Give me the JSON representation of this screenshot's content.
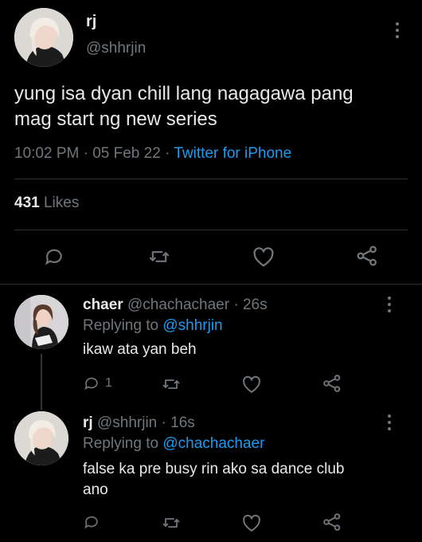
{
  "main_tweet": {
    "display_name": "rj",
    "handle": "@shhrjin",
    "text_line1": "yung isa dyan chill lang nagagawa pang",
    "text_line2": "mag start ng new series",
    "time": "10:02 PM",
    "sep1": "·",
    "date": "05 Feb 22",
    "sep2": "·",
    "source": "Twitter for iPhone",
    "likes_count": "431",
    "likes_label": "Likes"
  },
  "replies": [
    {
      "display_name": "chaer",
      "handle": "@chachachaer",
      "sep": "·",
      "age": "26s",
      "replying_prefix": "Replying to",
      "replying_to": "@shhrjin",
      "text": "ikaw ata yan beh",
      "reply_count": "1"
    },
    {
      "display_name": "rj",
      "handle": "@shhrjin",
      "sep": "·",
      "age": "16s",
      "replying_prefix": "Replying to",
      "replying_to": "@chachachaer",
      "text_line1": "false ka pre busy rin ako sa dance club",
      "text_line2": "ano"
    }
  ],
  "icons": [
    "reply-icon",
    "retweet-icon",
    "like-icon",
    "share-icon",
    "more-icon"
  ],
  "colors": {
    "background": "#000000",
    "text": "#e7e9ea",
    "muted": "#71767b",
    "link": "#1d9bf0",
    "divider": "#2f3336"
  }
}
